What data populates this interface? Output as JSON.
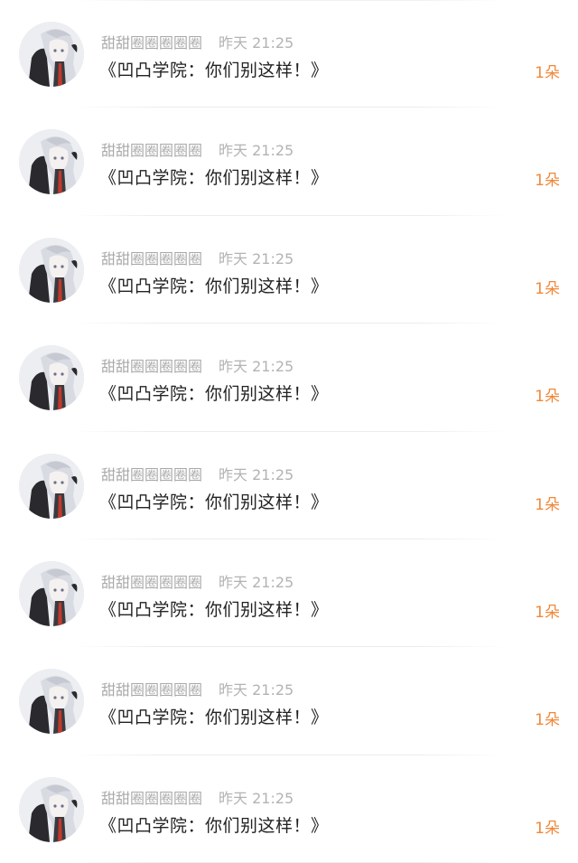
{
  "comments": [
    {
      "username": "甜甜圈圈圈圈圈",
      "time": "昨天 21:25",
      "message": "《凹凸学院：你们别这样！》",
      "count": "1朵",
      "avatar_icon": "avatar-anime-girl-icon"
    },
    {
      "username": "甜甜圈圈圈圈圈",
      "time": "昨天 21:25",
      "message": "《凹凸学院：你们别这样！》",
      "count": "1朵",
      "avatar_icon": "avatar-anime-girl-icon"
    },
    {
      "username": "甜甜圈圈圈圈圈",
      "time": "昨天 21:25",
      "message": "《凹凸学院：你们别这样！》",
      "count": "1朵",
      "avatar_icon": "avatar-anime-girl-icon"
    },
    {
      "username": "甜甜圈圈圈圈圈",
      "time": "昨天 21:25",
      "message": "《凹凸学院：你们别这样！》",
      "count": "1朵",
      "avatar_icon": "avatar-anime-girl-icon"
    },
    {
      "username": "甜甜圈圈圈圈圈",
      "time": "昨天 21:25",
      "message": "《凹凸学院：你们别这样！》",
      "count": "1朵",
      "avatar_icon": "avatar-anime-girl-icon"
    },
    {
      "username": "甜甜圈圈圈圈圈",
      "time": "昨天 21:25",
      "message": "《凹凸学院：你们别这样！》",
      "count": "1朵",
      "avatar_icon": "avatar-anime-girl-icon"
    },
    {
      "username": "甜甜圈圈圈圈圈",
      "time": "昨天 21:25",
      "message": "《凹凸学院：你们别这样！》",
      "count": "1朵",
      "avatar_icon": "avatar-anime-girl-icon"
    },
    {
      "username": "甜甜圈圈圈圈圈",
      "time": "昨天 21:25",
      "message": "《凹凸学院：你们别这样！》",
      "count": "1朵",
      "avatar_icon": "avatar-anime-girl-icon"
    }
  ],
  "colors": {
    "username": "#a9a9a9",
    "time": "#b3b3b3",
    "message": "#222222",
    "count": "#f0883a",
    "background": "#ffffff"
  }
}
